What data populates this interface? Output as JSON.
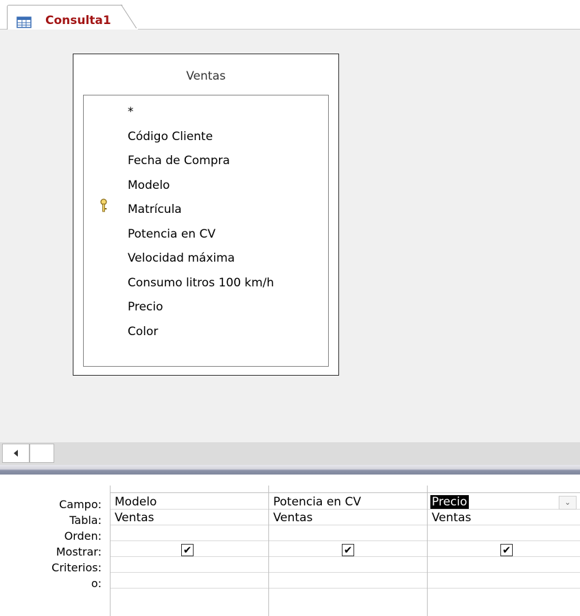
{
  "tab": {
    "label": "Consulta1"
  },
  "table": {
    "title": "Ventas",
    "fields": [
      {
        "label": "*",
        "key": false
      },
      {
        "label": "Código Cliente",
        "key": false
      },
      {
        "label": "Fecha de Compra",
        "key": false
      },
      {
        "label": "Modelo",
        "key": false
      },
      {
        "label": "Matrícula",
        "key": true
      },
      {
        "label": "Potencia en CV",
        "key": false
      },
      {
        "label": "Velocidad máxima",
        "key": false
      },
      {
        "label": "Consumo litros 100 km/h",
        "key": false
      },
      {
        "label": "Precio",
        "key": false
      },
      {
        "label": "Color",
        "key": false
      }
    ]
  },
  "grid": {
    "row_labels": [
      "Campo:",
      "Tabla:",
      "Orden:",
      "Mostrar:",
      "Criterios:",
      "o:"
    ],
    "columns": [
      {
        "campo": "Modelo",
        "tabla": "Ventas",
        "orden": "",
        "mostrar": true,
        "criterios": "",
        "o": ""
      },
      {
        "campo": "Potencia en CV",
        "tabla": "Ventas",
        "orden": "",
        "mostrar": true,
        "criterios": "",
        "o": ""
      },
      {
        "campo": "Precio",
        "tabla": "Ventas",
        "orden": "",
        "mostrar": true,
        "criterios": "",
        "o": "",
        "selected": true
      }
    ],
    "checkmark": "✔",
    "dropdown_icon": "⌄"
  },
  "colors": {
    "tab_text": "#a31515",
    "design_bg": "#f0f0f0"
  }
}
